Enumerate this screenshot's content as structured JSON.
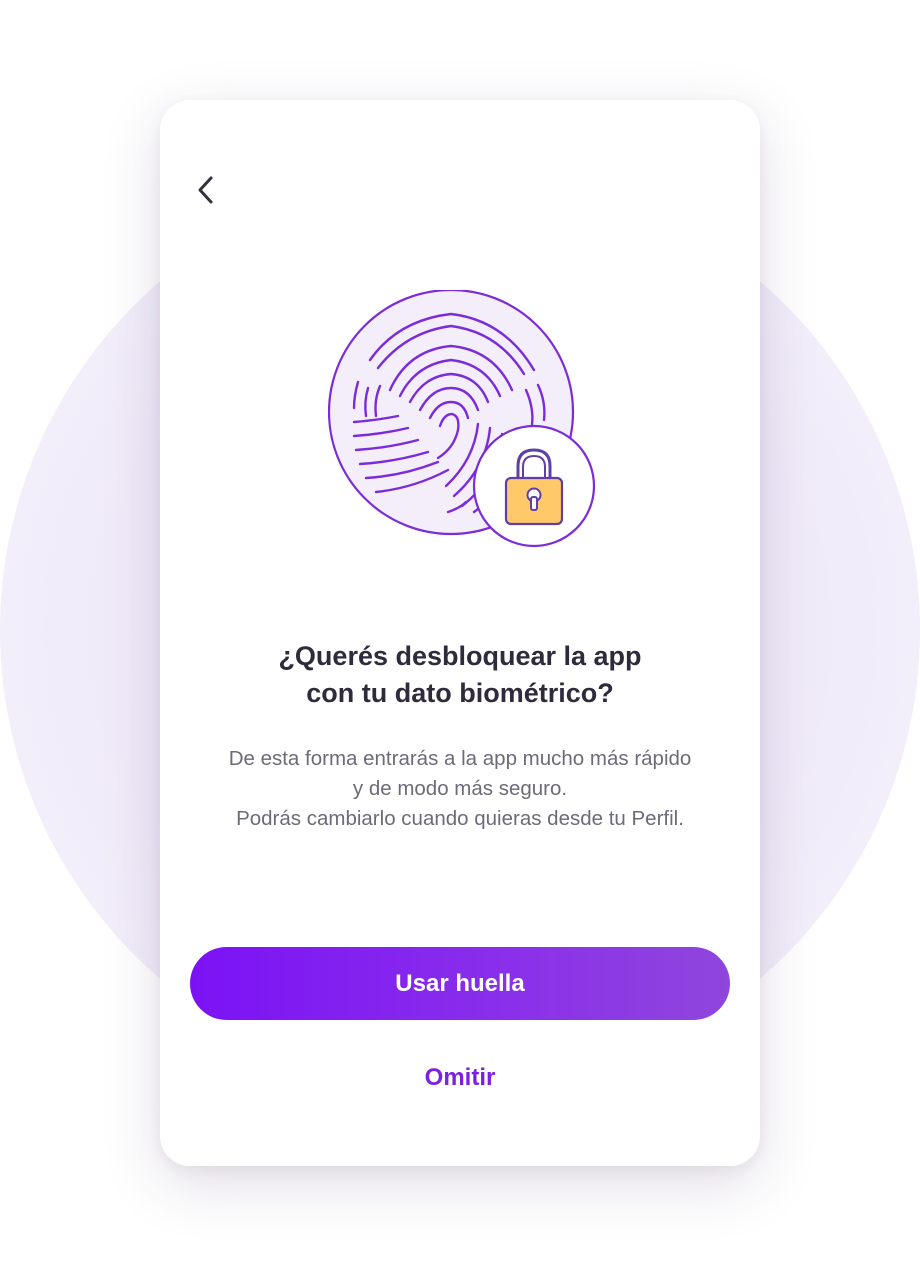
{
  "header": {
    "back_icon": "chevron-left-icon"
  },
  "illustration": {
    "fingerprint_icon": "fingerprint-icon",
    "lock_icon": "padlock-icon",
    "colors": {
      "stroke": "#7b2cd9",
      "fill": "#f4eefb",
      "lock_body": "#ffc96a",
      "lock_shackle": "#5f3fa5"
    }
  },
  "content": {
    "title_lines": [
      "¿Querés desbloquear la app",
      "con tu dato biométrico?"
    ],
    "description_lines": [
      "De esta forma entrarás a la app mucho más rápido",
      "y de modo más seguro.",
      "Podrás cambiarlo cuando quieras desde tu Perfil."
    ]
  },
  "actions": {
    "primary_label": "Usar huella",
    "secondary_label": "Omitir"
  },
  "colors": {
    "accent": "#7d20e6",
    "button_gradient_start": "#7b12f5",
    "button_gradient_end": "#8f46dc",
    "title": "#2f2b3d",
    "body": "#6e6a78"
  }
}
